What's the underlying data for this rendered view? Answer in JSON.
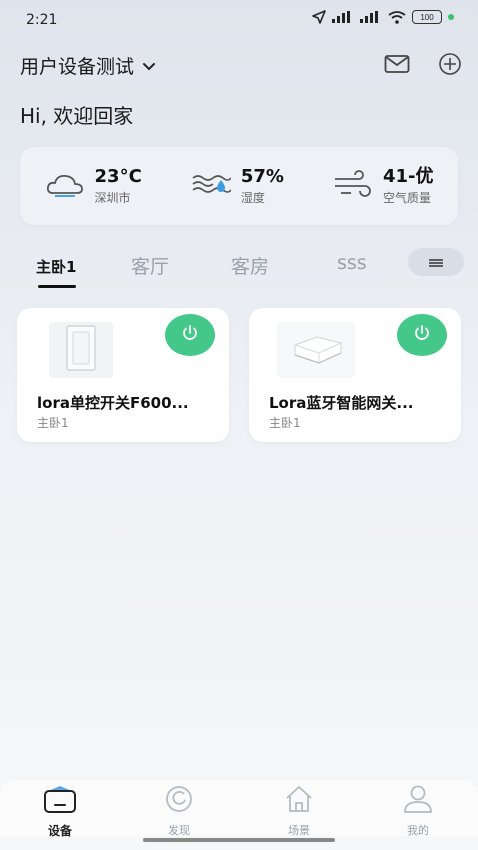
{
  "status_bar": {
    "time": "2:21",
    "battery": "100",
    "battery_dot_color": "#35c46c"
  },
  "header": {
    "title": "用户设备测试",
    "chevron": "⌄",
    "icons": [
      "mail-icon",
      "add-circle-icon"
    ]
  },
  "greeting": "Hi, 欢迎回家",
  "weather": {
    "temperature": {
      "value": "23°C",
      "label": "深圳市",
      "icon": "cloud-icon"
    },
    "humidity": {
      "value": "57%",
      "label": "湿度",
      "icon": "humidity-icon"
    },
    "air": {
      "value": "41-优",
      "label": "空气质量",
      "icon": "wind-icon"
    }
  },
  "tabs": [
    {
      "label": "主卧1",
      "active": true
    },
    {
      "label": "客厅",
      "active": false
    },
    {
      "label": "客房",
      "active": false
    },
    {
      "label": "sss",
      "active": false
    }
  ],
  "devices": [
    {
      "name": "lora单控开关F600...",
      "room": "主卧1",
      "icon": "wall-switch-icon"
    },
    {
      "name": "Lora蓝牙智能网关...",
      "room": "主卧1",
      "icon": "gateway-icon"
    }
  ],
  "accent_color": "#43c88a",
  "bottom_nav": [
    {
      "label": "设备",
      "icon": "devices-icon",
      "active": true
    },
    {
      "label": "发现",
      "icon": "discover-icon",
      "active": false
    },
    {
      "label": "场景",
      "icon": "scene-home-icon",
      "active": false
    },
    {
      "label": "我的",
      "icon": "profile-icon",
      "active": false
    }
  ]
}
